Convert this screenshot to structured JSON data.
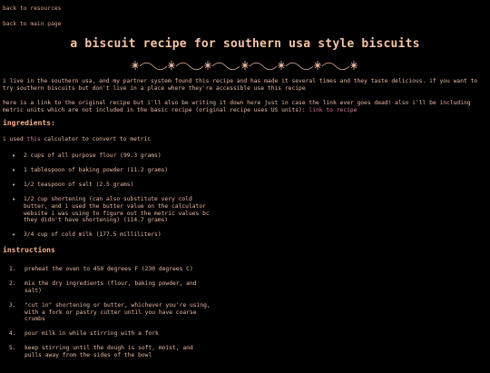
{
  "nav": {
    "back_resources": "back to resources",
    "back_main": "back to main page"
  },
  "title": "a biscuit recipe for southern usa style biscuits",
  "divider_icon": "floral-vine-divider",
  "intro": {
    "p1": "i live in the southern usa, and my partner system found this recipe and has made it several times and they taste delicious. if you want to try southern biscuits but don't live in a place where they're accessible use this recipe",
    "p2_text": "here is a link to the original recipe but i'll also be writing it down here just in case the link ever goes dead! also i'll be including metric units which are not included in the basic recipe (original recipe uses US units): ",
    "p2_link": "link to recipe"
  },
  "ingredients": {
    "heading": "ingredients:",
    "calc_before": "i used ",
    "calc_link": "this",
    "calc_after": " calculator to convert to metric",
    "items": [
      "2 cups of all purpose flour (99.3 grams)",
      "1 tablespoon of baking powder (11.2 grams)",
      "1/2 teaspoon of salt (2.5 grams)",
      "1/2 cup shortening (can also substitute very cold butter, and i used the butter value on the calculator website i was using to figure out the metric values bc they didn't have shortening) (114.7 grams)",
      "3/4 cup of cold milk (177.5 milliliters)"
    ]
  },
  "instructions": {
    "heading": "instructions",
    "steps": [
      {
        "num": "1.",
        "text": "preheat the oven to 450 degrees F (230 degrees C)"
      },
      {
        "num": "2.",
        "text": "mix the dry ingredients (flour, baking powder, and salt)"
      },
      {
        "num": "3.",
        "text": "\"cut in\" shortening or butter, whichever you're using, with a fork or pastry cutter until you have coarse crumbs"
      },
      {
        "num": "4.",
        "text": "pour milk in while stirring with a fork"
      },
      {
        "num": "5.",
        "text": "keep stirring until the dough is soft, moist, and pulls away from the sides of the bowl"
      }
    ]
  },
  "colors": {
    "background": "#000000",
    "text": "#e8b8a0",
    "link": "#e07a98",
    "divider": "#e8b8a0"
  }
}
